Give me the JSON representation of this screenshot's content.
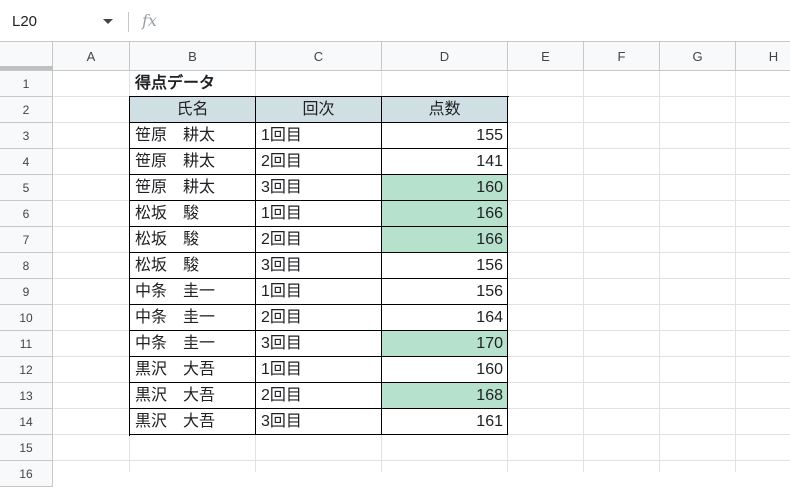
{
  "formula_bar": {
    "cell_ref": "L20",
    "fx_label": "fx",
    "formula": ""
  },
  "columns": [
    "A",
    "B",
    "C",
    "D",
    "E",
    "F",
    "G",
    "H"
  ],
  "rows": [
    "1",
    "2",
    "3",
    "4",
    "5",
    "6",
    "7",
    "8",
    "9",
    "10",
    "11",
    "12",
    "13",
    "14",
    "15",
    "16"
  ],
  "sheet": {
    "title": "得点データ",
    "headers": [
      "氏名",
      "回次",
      "点数"
    ],
    "records": [
      {
        "name": "笹原　耕太",
        "round": "1回目",
        "score": "155",
        "highlight": false
      },
      {
        "name": "笹原　耕太",
        "round": "2回目",
        "score": "141",
        "highlight": false
      },
      {
        "name": "笹原　耕太",
        "round": "3回目",
        "score": "160",
        "highlight": true
      },
      {
        "name": "松坂　駿",
        "round": "1回目",
        "score": "166",
        "highlight": true
      },
      {
        "name": "松坂　駿",
        "round": "2回目",
        "score": "166",
        "highlight": true
      },
      {
        "name": "松坂　駿",
        "round": "3回目",
        "score": "156",
        "highlight": false
      },
      {
        "name": "中条　圭一",
        "round": "1回目",
        "score": "156",
        "highlight": false
      },
      {
        "name": "中条　圭一",
        "round": "2回目",
        "score": "164",
        "highlight": false
      },
      {
        "name": "中条　圭一",
        "round": "3回目",
        "score": "170",
        "highlight": true
      },
      {
        "name": "黒沢　大吾",
        "round": "1回目",
        "score": "160",
        "highlight": false
      },
      {
        "name": "黒沢　大吾",
        "round": "2回目",
        "score": "168",
        "highlight": true
      },
      {
        "name": "黒沢　大吾",
        "round": "3回目",
        "score": "161",
        "highlight": false
      }
    ]
  },
  "colors": {
    "header_fill": "#d0dfe3",
    "highlight_fill": "#b6e1cd"
  }
}
